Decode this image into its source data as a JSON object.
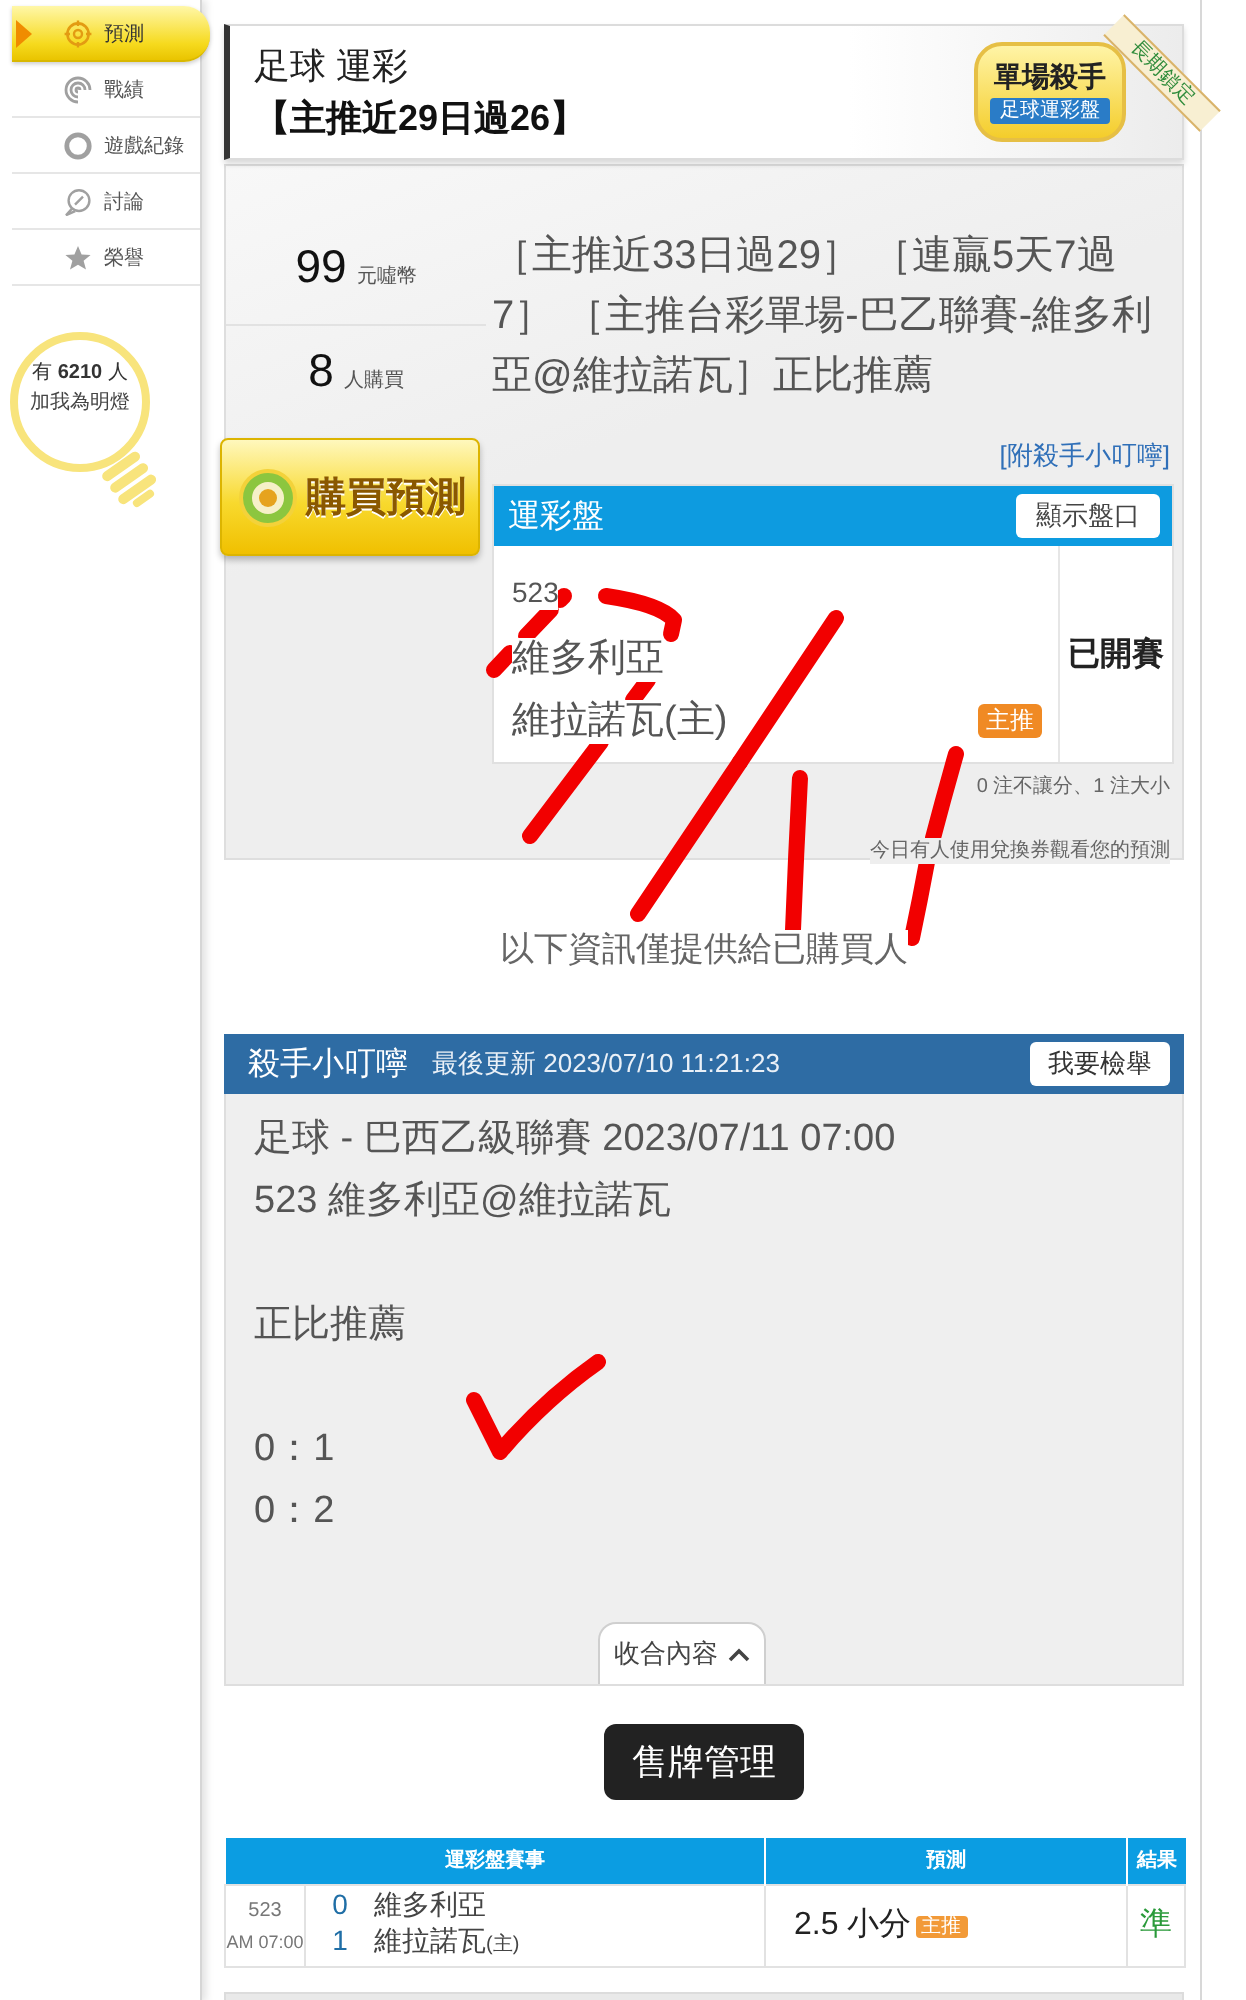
{
  "sidebar": {
    "items": [
      {
        "label": "預測",
        "selected": true
      },
      {
        "label": "戰績",
        "selected": false
      },
      {
        "label": "遊戲紀錄",
        "selected": false
      },
      {
        "label": "討論",
        "selected": false
      },
      {
        "label": "榮譽",
        "selected": false
      }
    ],
    "fans": {
      "count_line": "有 **6210** 人",
      "caption": "加我為明燈"
    }
  },
  "header": {
    "sport": "足球 運彩",
    "record": "【主推近29日過26】",
    "badge": {
      "title": "單場殺手",
      "ribbon": "足球運彩盤"
    },
    "corner_ribbon": "長期鎖定"
  },
  "offer": {
    "price": "99",
    "price_unit": "元噓幣",
    "buyers": "8",
    "buyers_unit": "人購買",
    "buy_button": "購買預測",
    "description": "［主推近33日過29］ ［連贏5天7過7］ ［主推台彩單場-巴乙聯賽-維多利亞@維拉諾瓦］正比推薦",
    "tip_link": "[附殺手小叮嚀]",
    "board": {
      "title": "運彩盤",
      "toggle_button": "顯示盤口",
      "game_no": "523",
      "teams": [
        "維多利亞",
        "維拉諾瓦(主)"
      ],
      "tag": "主推",
      "status": "已開賽"
    },
    "bet_counts": "0 注不讓分、1 注大小",
    "notice": "今日有人使用兌換券觀看您的預測"
  },
  "purchased_note": "以下資訊僅提供給已購買人",
  "tips": {
    "title": "殺手小叮嚀",
    "updated": "最後更新 2023/07/10 11:21:23",
    "report_button": "我要檢舉",
    "paragraphs": [
      [
        "足球 - 巴西乙級聯賽 2023/07/11 07:00",
        "523 維多利亞@維拉諾瓦"
      ],
      [
        "正比推薦"
      ],
      [
        "0：1",
        "0：2"
      ]
    ],
    "collapse_button": "收合內容"
  },
  "manage_button": "售牌管理",
  "results": {
    "columns": [
      "運彩盤賽事",
      "預測",
      "結果"
    ],
    "rows": [
      {
        "game_no": "523",
        "time": "AM 07:00",
        "teams": [
          {
            "score": "0",
            "name": "維多利亞"
          },
          {
            "score": "1",
            "name": "維拉諾瓦$_{(主)}$"
          }
        ],
        "pick": "2.5 小分",
        "tag": "主推",
        "result": "準"
      }
    ]
  }
}
